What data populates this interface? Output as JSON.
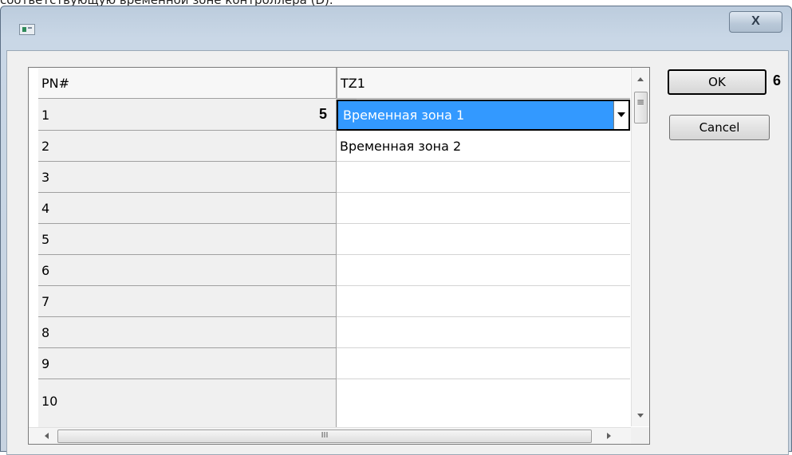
{
  "doc_caption": "соответствующую временной зоне контроллера (D).",
  "window": {
    "close_label": "X"
  },
  "grid": {
    "columns": [
      "PN#",
      "TZ1"
    ],
    "rows": [
      {
        "pn": "1",
        "tz": "Временная зона 1"
      },
      {
        "pn": "2",
        "tz": "Временная зона 2"
      },
      {
        "pn": "3",
        "tz": ""
      },
      {
        "pn": "4",
        "tz": ""
      },
      {
        "pn": "5",
        "tz": ""
      },
      {
        "pn": "6",
        "tz": ""
      },
      {
        "pn": "7",
        "tz": ""
      },
      {
        "pn": "8",
        "tz": ""
      },
      {
        "pn": "9",
        "tz": ""
      },
      {
        "pn": "10",
        "tz": ""
      }
    ],
    "hscroll_grip": "III"
  },
  "annotations": {
    "cell_marker": "5",
    "ok_marker": "6"
  },
  "buttons": {
    "ok": "OK",
    "cancel": "Cancel"
  }
}
